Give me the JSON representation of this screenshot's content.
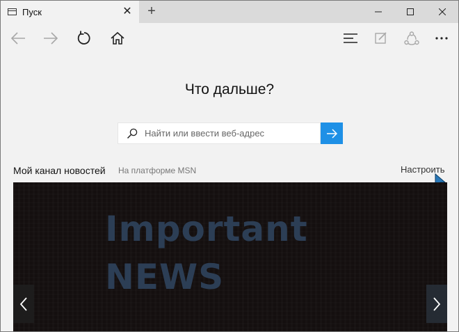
{
  "tab": {
    "title": "Пуск",
    "close_glyph": "✕"
  },
  "new_tab_glyph": "+",
  "main": {
    "heading": "Что дальше?",
    "search": {
      "placeholder": "Найти или ввести веб-адрес"
    }
  },
  "news": {
    "title": "Мой канал новостей",
    "source": "На платформе MSN",
    "customize": "Настроить",
    "headline_line1": "Important",
    "headline_line2": "NEWS"
  },
  "icons": {
    "back": "arrow-left-icon",
    "forward": "arrow-right-icon",
    "refresh": "refresh-icon",
    "home": "home-icon",
    "hub": "hub-icon",
    "note": "web-note-icon",
    "share": "share-icon",
    "more": "more-icon"
  },
  "colors": {
    "accent": "#1e90e6",
    "news_bg": "#140f0f",
    "headline": "#2c3e55"
  }
}
